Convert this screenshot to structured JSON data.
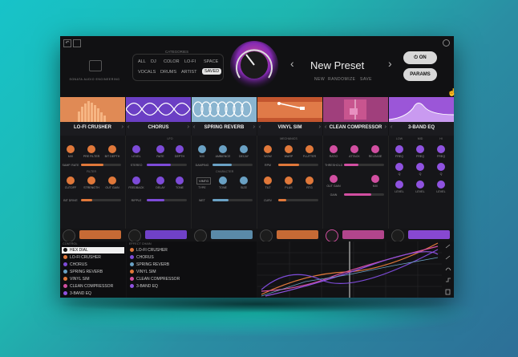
{
  "header": {
    "brand": "SONATA AUDIO ENGINEERING",
    "categories_title": "CATEGORIES",
    "categories": [
      "ALL",
      "DJ",
      "COLOR",
      "LO-FI",
      "SPACE",
      "VOCALS",
      "DRUMS",
      "ARTIST",
      "SAVED"
    ],
    "preset_name": "New Preset",
    "preset_actions": [
      "NEW",
      "RANDOMIZE",
      "SAVE"
    ],
    "on_label": "ON",
    "params_label": "PARAMS"
  },
  "modules": [
    {
      "name": "LO-FI CRUSHER",
      "color": "#e0783a"
    },
    {
      "name": "CHORUS",
      "color": "#7d4bd8"
    },
    {
      "name": "SPRING REVERB",
      "color": "#6aa1c4"
    },
    {
      "name": "VINYL SIM",
      "color": "#e0783a"
    },
    {
      "name": "CLEAN COMPRESSOR",
      "color": "#d24fa1"
    },
    {
      "name": "3-BAND EQ",
      "color": "#8f52e0"
    }
  ],
  "labels": {
    "m1": [
      "MIX",
      "PRE FILTER",
      "BIT DEPTH",
      "SAMP. RATE",
      "CUTOFF",
      "STRENGTH",
      "OUT GAIN",
      "BIT DRIVE"
    ],
    "m1_group": "FILTER",
    "m2": [
      "LEVEL",
      "RATE",
      "DEPTH",
      "STEREO",
      "FEEDBACK",
      "DELAY",
      "TONE",
      "RIPPLE"
    ],
    "m2_group": "LFO",
    "m3": [
      "MIX",
      "AMBIENCE",
      "DECAY",
      "DAMPING",
      "TYPE",
      "TONE",
      "SIZE",
      "WET"
    ],
    "m3_group": "CHARACTER",
    "m3_vintage": "VINTG",
    "m4": [
      "WOW",
      "WARP",
      "FLUTTER",
      "RPM",
      "TILT",
      "PLUS",
      "RTG",
      "CURV"
    ],
    "m4_group": "MECHANICS",
    "m5": [
      "RATIO",
      "ATTACK",
      "RELEASE",
      "THRESHOLD",
      "OUT GAIN",
      "MIX",
      "GAIN"
    ],
    "m6": [
      "FREQ",
      "FREQ",
      "FREQ",
      "Q",
      "Q",
      "Q",
      "LEVEL",
      "LEVEL",
      "LEVEL"
    ],
    "m6_groups": [
      "LOW",
      "MID",
      "HI"
    ]
  },
  "controls": {
    "title": "CONTROL",
    "items": [
      {
        "label": "HEX DIAL",
        "color": "#111111",
        "selected": true
      },
      {
        "label": "LO-FI CRUSHER",
        "color": "#e0783a"
      },
      {
        "label": "CHORUS",
        "color": "#7d4bd8"
      },
      {
        "label": "SPRING REVERB",
        "color": "#6aa1c4"
      },
      {
        "label": "VINYL SIM",
        "color": "#e0783a"
      },
      {
        "label": "CLEAN COMPRESSOR",
        "color": "#d24fa1"
      },
      {
        "label": "3-BAND EQ",
        "color": "#8f52e0"
      }
    ]
  },
  "effect_chain": {
    "title": "EFFECT CHAIN",
    "items": [
      {
        "label": "LO-FI CRUSHER",
        "color": "#e0783a"
      },
      {
        "label": "CHORUS",
        "color": "#7d4bd8"
      },
      {
        "label": "SPRING REVERB",
        "color": "#6aa1c4"
      },
      {
        "label": "VINYL SIM",
        "color": "#e0783a"
      },
      {
        "label": "CLEAN COMPRESSOR",
        "color": "#d24fa1"
      },
      {
        "label": "3-BAND EQ",
        "color": "#8f52e0"
      }
    ]
  }
}
